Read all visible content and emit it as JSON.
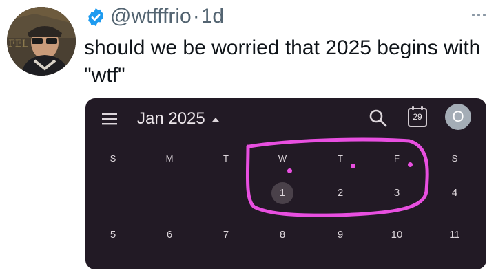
{
  "tweet": {
    "handle": "@wtfffrio",
    "separator": "·",
    "time": "1d",
    "text": "should we be worried that 2025 begins with \"wtf\"",
    "verified_color": "#1d9bf0"
  },
  "calendar": {
    "month_label": "Jan 2025",
    "today_badge": "29",
    "account_initial": "O",
    "weekday_labels": [
      "S",
      "M",
      "T",
      "W",
      "T",
      "F",
      "S"
    ],
    "week1": [
      "",
      "",
      "",
      "1",
      "2",
      "3",
      "4"
    ],
    "week2": [
      "5",
      "6",
      "7",
      "8",
      "9",
      "10",
      "11"
    ],
    "highlight_color": "#e84fe0",
    "event_dot_color": "#e84fe0"
  },
  "icons": {
    "menu": "menu-icon",
    "caret": "caret-up-icon",
    "search": "search-icon",
    "today": "calendar-today-icon",
    "more": "more-icon",
    "verified": "verified-badge-icon"
  }
}
